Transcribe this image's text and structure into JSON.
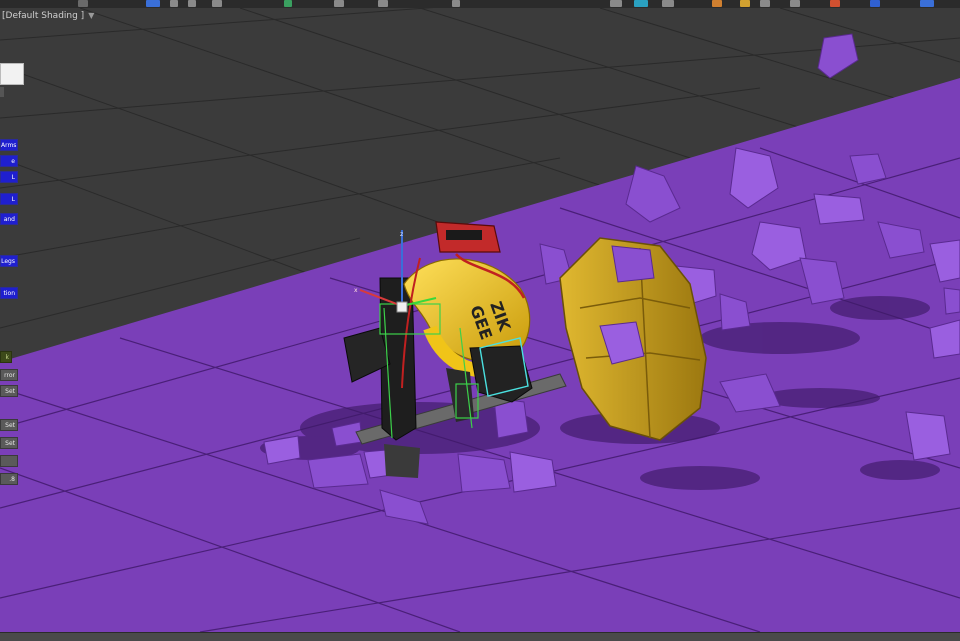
{
  "viewport": {
    "label": "[Default Shading ]",
    "filter_icon": "funnel-icon"
  },
  "side_panel": {
    "buttons": [
      {
        "label": "Arms",
        "style": "blue"
      },
      {
        "label": "e",
        "style": "blue"
      },
      {
        "label": "L",
        "style": "blue"
      },
      {
        "label": "L",
        "style": "blue"
      },
      {
        "label": "and",
        "style": "blue"
      },
      {
        "label": "Legs",
        "style": "blue"
      },
      {
        "label": "tion",
        "style": "blue"
      },
      {
        "label": "k",
        "style": "green"
      },
      {
        "label": "rror",
        "style": "gray"
      },
      {
        "label": "Set",
        "style": "gray"
      },
      {
        "label": "Set",
        "style": "gray"
      },
      {
        "label": "Set",
        "style": "gray"
      },
      {
        "label": "",
        "style": "gray"
      },
      {
        "label": ".8",
        "style": "gray"
      }
    ]
  },
  "toolbar": {
    "icons": [
      "select-icon",
      "rotate-icon",
      "move-icon",
      "scale-icon",
      "snap-icon",
      "layer-icon",
      "render-setup-icon",
      "render-icon",
      "material-icon"
    ]
  },
  "colors": {
    "ground": "#7a3fb8",
    "grid_background": "#3b3b3b",
    "debris": "#8a4fd0",
    "shield": "#c8a020",
    "character_jacket": "#f0c418",
    "ui_blue": "#1f1fcf"
  }
}
